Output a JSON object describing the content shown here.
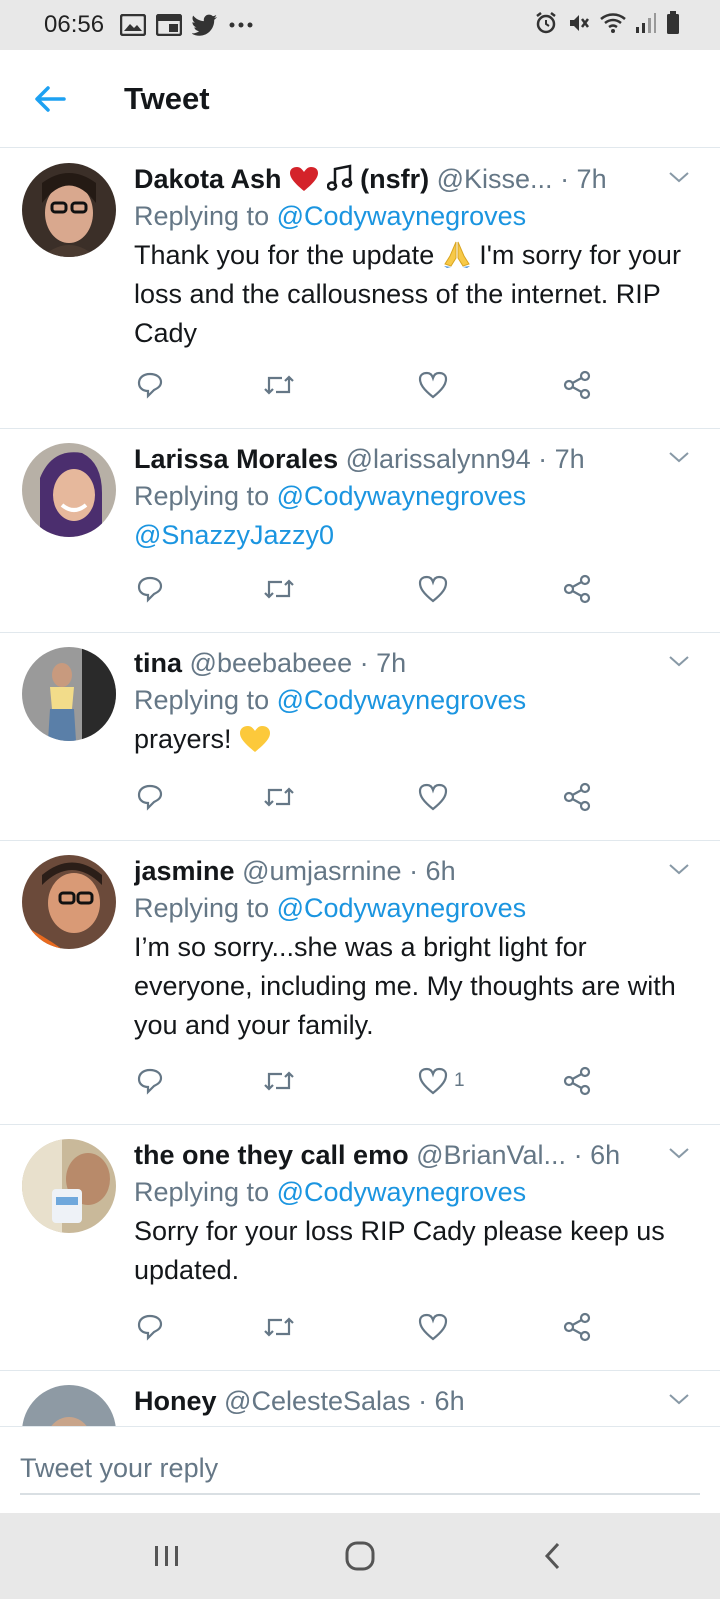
{
  "status_bar": {
    "time": "06:56",
    "left_icons": [
      "gallery-icon",
      "calendar-icon",
      "twitter-icon",
      "more-dots-icon"
    ],
    "right_icons": [
      "alarm-icon",
      "mute-icon",
      "wifi-icon",
      "signal-icon",
      "battery-icon"
    ]
  },
  "header": {
    "title": "Tweet"
  },
  "colors": {
    "link": "#1b95e0",
    "muted": "#657786",
    "text": "#14171a",
    "divider": "#e1e8ed",
    "back_arrow": "#1da1f2"
  },
  "tweets": [
    {
      "name": "Dakota Ash",
      "name_suffix": "(nsfr)",
      "handle": "@Kisse...",
      "time": "· 7h",
      "replying_label": "Replying to",
      "replying_to": "@Codywaynegroves",
      "text_1": "Thank you for the update",
      "text_2": "I'm sorry for your loss and the callousness of the internet. RIP Cady",
      "like_count": ""
    },
    {
      "name": "Larissa Morales",
      "handle": "@larissalynn94",
      "time": "· 7h",
      "replying_label": "Replying to",
      "replying_to": "@Codywaynegroves",
      "text_mention": "@SnazzyJazzy0",
      "like_count": ""
    },
    {
      "name": "tina",
      "handle": "@beebabeee",
      "time": "· 7h",
      "replying_label": "Replying to",
      "replying_to": "@Codywaynegroves",
      "text": "prayers!",
      "like_count": ""
    },
    {
      "name": "jasmine",
      "handle": "@umjasrnine",
      "time": "· 6h",
      "replying_label": "Replying to",
      "replying_to": "@Codywaynegroves",
      "text": "I’m so sorry...she was a bright light for everyone, including me. My thoughts are with you and your family.",
      "like_count": "1"
    },
    {
      "name": "the one they call emo",
      "handle": "@BrianVal...",
      "time": "· 6h",
      "replying_label": "Replying to",
      "replying_to": "@Codywaynegroves",
      "text": "Sorry for your loss RIP Cady please keep us updated.",
      "like_count": ""
    },
    {
      "name": "Honey",
      "handle": "@CelesteSalas",
      "time": "· 6h"
    }
  ],
  "reply_bar": {
    "placeholder": "Tweet your reply"
  },
  "nav_bar": {
    "buttons": [
      "recent-apps-icon",
      "home-icon",
      "back-icon"
    ]
  }
}
